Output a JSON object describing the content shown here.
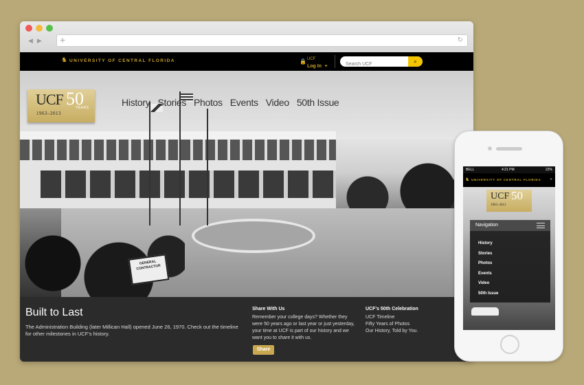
{
  "site": {
    "brand": "UNIVERSITY OF CENTRAL FLORIDA",
    "login_small": "UCF",
    "login_label": "Log In",
    "search_placeholder": "Search UCF"
  },
  "logo": {
    "ucf": "UCF",
    "fifty": "50",
    "years_range": "1963–2013",
    "years_word": "YEARS"
  },
  "nav": {
    "items": [
      "History",
      "Stories",
      "Photos",
      "Events",
      "Video",
      "50th Issue"
    ]
  },
  "hero": {
    "sign_text": "GENERAL CONTRACTOR"
  },
  "footer": {
    "title": "Built to Last",
    "description": "The Administration Building (later Millican Hall) opened June 26, 1970. Check out the timeline for other milestones in UCF’s history.",
    "share_heading": "Share With Us",
    "share_text": "Remember your college days? Whether they were 50 years ago or last year or just yesterday, your time at UCF is part of our history and we want you to share it with us.",
    "share_button": "Share",
    "celebration_heading": "UCF’s 50th Celebration",
    "celebration_links": [
      "UCF Timeline",
      "Fifty Years of Photos",
      "Our History, Told by You."
    ]
  },
  "phone": {
    "carrier": "BELL",
    "time": "4:21 PM",
    "battery": "22%",
    "brand": "UNIVERSITY OF CENTRAL FLORIDA",
    "nav_heading": "Navigation",
    "nav_items": [
      "History",
      "Stories",
      "Photos",
      "Events",
      "Video",
      "50th Issue"
    ]
  },
  "colors": {
    "gold": "#c9a227",
    "background": "#b9a978",
    "footer": "#2b2b2b"
  }
}
